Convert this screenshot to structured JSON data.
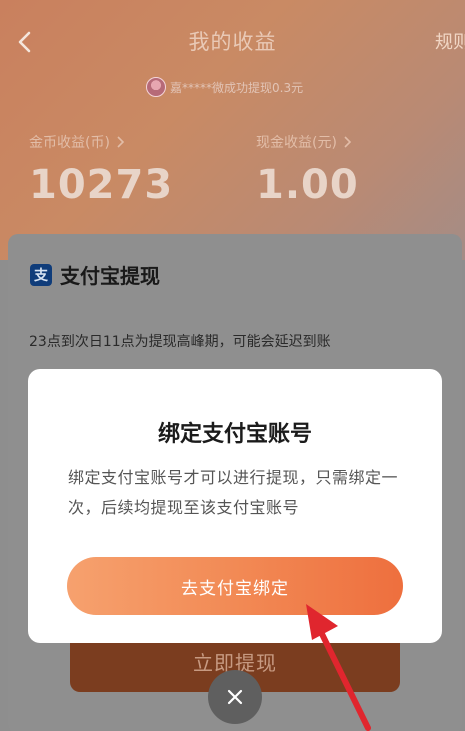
{
  "header": {
    "title": "我的收益",
    "right_link": "规则",
    "back_icon": "chevron-left-icon"
  },
  "marquee": {
    "text": "嘉*****微成功提现0.3元"
  },
  "stats": {
    "coin": {
      "label": "金币收益(币)",
      "value": "10273"
    },
    "cash": {
      "label": "现金收益(元)",
      "value": "1.00"
    }
  },
  "card": {
    "logo_glyph": "支",
    "title": "支付宝提现",
    "notice": "23点到次日11点为提现高峰期，可能会延迟到账",
    "withdraw_label": "立即提现"
  },
  "dialog": {
    "title": "绑定支付宝账号",
    "description": "绑定支付宝账号才可以进行提现，只需绑定一次，后续均提现至该支付宝账号",
    "bind_label": "去支付宝绑定",
    "close_icon": "close-icon"
  },
  "colors": {
    "header_start": "#c9805e",
    "header_end": "#a48c86",
    "bind_button_start": "#f6a16e",
    "bind_button_end": "#ee6f3e",
    "withdraw_button": "#7b3d1f",
    "annotation_arrow": "#e0262e",
    "alipay_logo": "#0f3c7a"
  }
}
